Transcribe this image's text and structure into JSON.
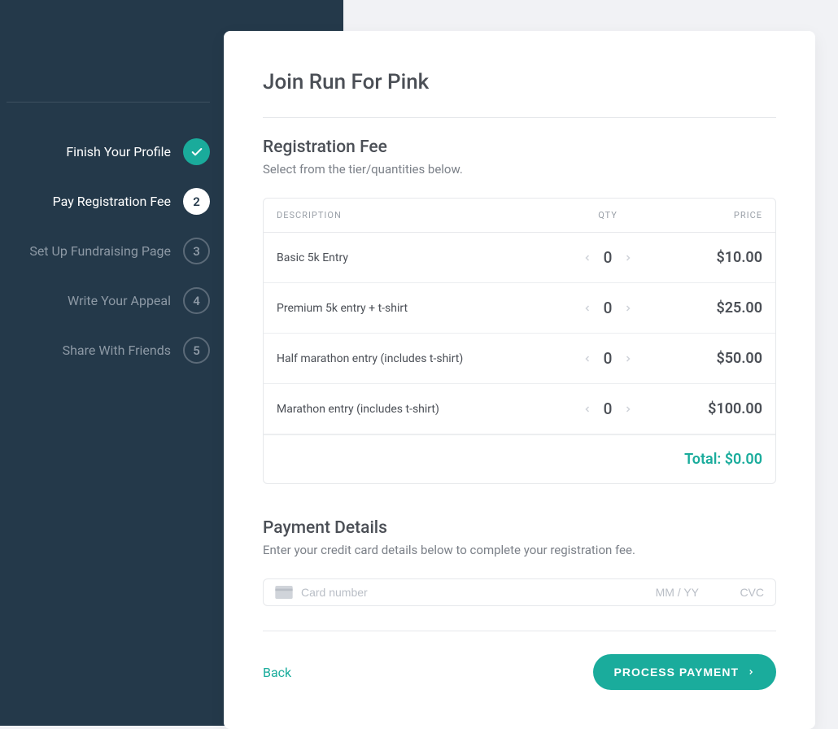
{
  "sidebar": {
    "steps": [
      {
        "label": "Finish Your Profile",
        "state": "completed",
        "badge": "✓"
      },
      {
        "label": "Pay Registration Fee",
        "state": "active",
        "badge": "2"
      },
      {
        "label": "Set Up Fundraising Page",
        "state": "pending",
        "badge": "3"
      },
      {
        "label": "Write Your Appeal",
        "state": "pending",
        "badge": "4"
      },
      {
        "label": "Share With Friends",
        "state": "pending",
        "badge": "5"
      }
    ]
  },
  "header": {
    "title": "Join Run For Pink"
  },
  "registration": {
    "title": "Registration Fee",
    "subtext": "Select from the tier/quantities below.",
    "columns": {
      "desc": "Description",
      "qty": "Qty",
      "price": "Price"
    },
    "items": [
      {
        "desc": "Basic 5k Entry",
        "qty": "0",
        "price": "$10.00"
      },
      {
        "desc": "Premium 5k entry + t-shirt",
        "qty": "0",
        "price": "$25.00"
      },
      {
        "desc": "Half marathon entry (includes t-shirt)",
        "qty": "0",
        "price": "$50.00"
      },
      {
        "desc": "Marathon entry (includes t-shirt)",
        "qty": "0",
        "price": "$100.00"
      }
    ],
    "total_label": "Total: $0.00"
  },
  "payment": {
    "title": "Payment Details",
    "subtext": "Enter your credit card details below to complete your registration fee.",
    "card_placeholder": "Card number",
    "exp_placeholder": "MM / YY",
    "cvc_placeholder": "CVC"
  },
  "footer": {
    "back": "Back",
    "process": "PROCESS PAYMENT"
  },
  "colors": {
    "accent": "#1aac9c",
    "sidebar_bg": "#24394a"
  }
}
